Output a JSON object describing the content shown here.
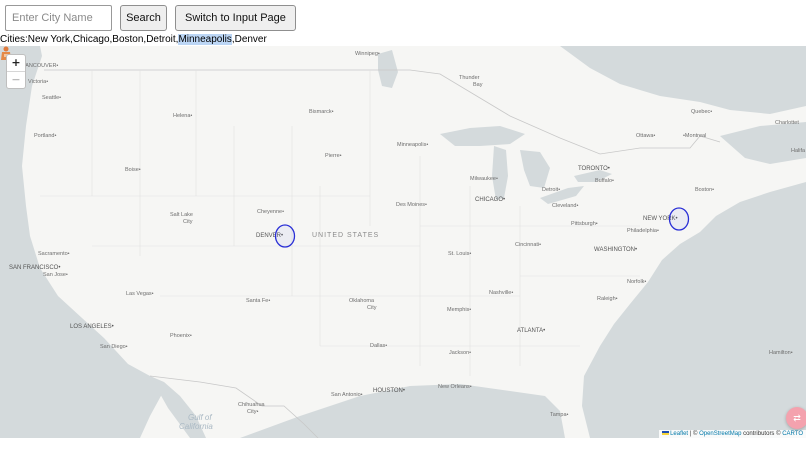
{
  "search": {
    "placeholder": "Enter City Name",
    "value": "",
    "button_label": "Search",
    "switch_label": "Switch to Input Page"
  },
  "cities_line": {
    "prefix": "Cities:",
    "before_highlight": "New York,Chicago,Boston,Detroit,",
    "highlighted": "Minneapolis",
    "after_highlight": ",Denver"
  },
  "map": {
    "zoom_in_label": "+",
    "zoom_out_label": "−",
    "country_label": "UNITED STATES",
    "water_labels": {
      "gulf_line1": "Gulf of",
      "gulf_line2": "California"
    },
    "cities": {
      "vancouver": "VANCOUVER•",
      "victoria": "Victoria•",
      "seattle": "Seattle•",
      "portland": "Portland•",
      "helena": "Helena•",
      "boise": "Boise•",
      "salt_lake_1": "Salt Lake",
      "salt_lake_2": "City",
      "cheyenne": "Cheyenne•",
      "denver": "DENVER•",
      "sacramento": "Sacramento•",
      "san_francisco": "SAN FRANCISCO•",
      "san_jose": "San Jose•",
      "las_vegas": "Las Vegas•",
      "los_angeles": "LOS ANGELES•",
      "san_diego": "San Diego•",
      "phoenix": "Phoenix•",
      "santa_fe": "Santa Fe•",
      "chihuahua_1": "Chihuahua",
      "chihuahua_2": "City•",
      "winnipeg": "Winnipeg•",
      "bismarck": "Bismarck•",
      "pierre": "Pierre•",
      "minneapolis": "Minneapolis•",
      "des_moines": "Des Moines•",
      "oklahoma_1": "Oklahoma",
      "oklahoma_2": "City",
      "dallas": "Dallas•",
      "houston": "HOUSTON•",
      "san_antonio": "San Antonio•",
      "new_orleans": "New Orleans•",
      "jackson": "Jackson•",
      "memphis": "Memphis•",
      "st_louis": "St. Louis•",
      "nashville": "Nashville•",
      "atlanta": "ATLANTA•",
      "tampa": "Tampa•",
      "chicago": "CHICAGO•",
      "milwaukee": "Milwaukee•",
      "detroit": "Detroit•",
      "cleveland": "Cleveland•",
      "pittsburgh": "Pittsburgh•",
      "cincinnati": "Cincinnati•",
      "washington": "WASHINGTON•",
      "philadelphia": "Philadelphia•",
      "new_york": "NEW YORK•",
      "boston": "Boston•",
      "norfolk": "Norfolk•",
      "raleigh": "Raleigh•",
      "toronto": "TORONTO•",
      "buffalo": "Buffalo•",
      "ottawa": "Ottawa•",
      "montreal": "•Montreal",
      "quebec": "Quebec•",
      "thunder_bay_1": "Thunder",
      "thunder_bay_2": "Bay",
      "charlottetown": "Charlottet",
      "halifax": "Halifa",
      "hamilton": "Hamilton•"
    },
    "circle_color": "#2a2fd6",
    "water_color": "#d4dadc",
    "land_color": "#f6f6f4"
  },
  "attribution": {
    "leaflet": "Leaflet",
    "sep": " | © ",
    "osm": "OpenStreetMap",
    "contributors": " contributors © ",
    "carto": "CARTO"
  }
}
